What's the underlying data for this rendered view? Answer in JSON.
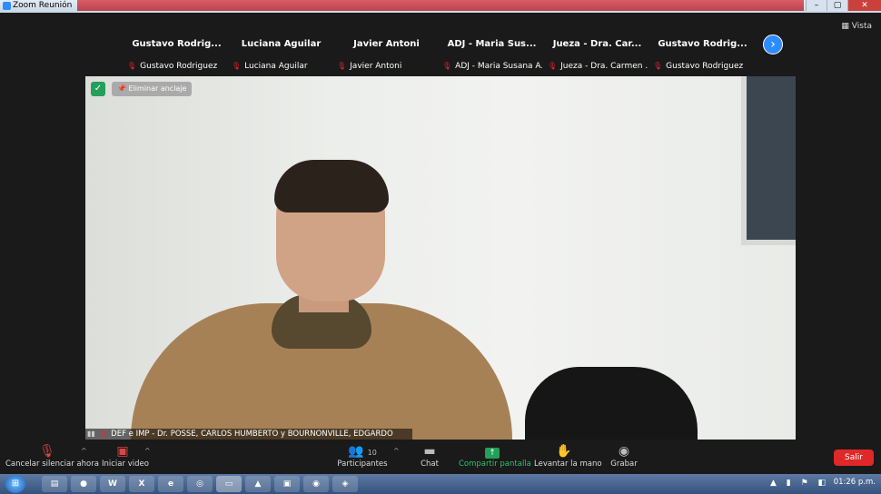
{
  "window": {
    "title": "Zoom Reunión",
    "controls": [
      "–",
      "▢",
      "✕"
    ]
  },
  "view_label": "Vista",
  "gallery": [
    {
      "big": "Gustavo  Rodrig...",
      "small": "Gustavo Rodriguez"
    },
    {
      "big": "Luciana Aguilar",
      "small": "Luciana Aguilar"
    },
    {
      "big": "Javier Antoni",
      "small": "Javier Antoni"
    },
    {
      "big": "ADJ - Maria Sus...",
      "small": "ADJ - Maria Susana A..."
    },
    {
      "big": "Jueza - Dra. Car...",
      "small": "Jueza - Dra. Carmen ..."
    },
    {
      "big": "Gustavo  Rodrig...",
      "small": "Gustavo Rodriguez"
    }
  ],
  "main_video": {
    "unpin_label": "Eliminar anclaje",
    "speaker_name": "DEF e IMP - Dr. POSSE, CARLOS HUMBERTO y BOURNONVILLE, EDGARDO"
  },
  "toolbar": {
    "unmute": "Cancelar silenciar ahora",
    "start_video": "Iniciar video",
    "participants": "Participantes",
    "participants_count": "10",
    "chat": "Chat",
    "share": "Compartir pantalla",
    "raise_hand": "Levantar la mano",
    "record": "Grabar",
    "leave": "Salir"
  },
  "taskbar": {
    "apps": [
      "▤",
      "●",
      "W",
      "X",
      "e",
      "◎",
      "▭",
      "▲",
      "▣",
      "◉",
      "◈"
    ],
    "tray_icons": "▲ ▮ ⚑ ◧",
    "clock": "01:26 p.m."
  },
  "colors": {
    "zoom_blue": "#2d8cff",
    "share_green": "#23a05a",
    "leave_red": "#e02828",
    "muted_red": "#e22233"
  },
  "icons": {
    "unmute": "mic-muted-icon",
    "video": "video-off-icon",
    "participants": "people-icon",
    "chat": "chat-bubble-icon",
    "share": "share-screen-icon",
    "raise_hand": "hand-icon",
    "record": "record-icon"
  }
}
